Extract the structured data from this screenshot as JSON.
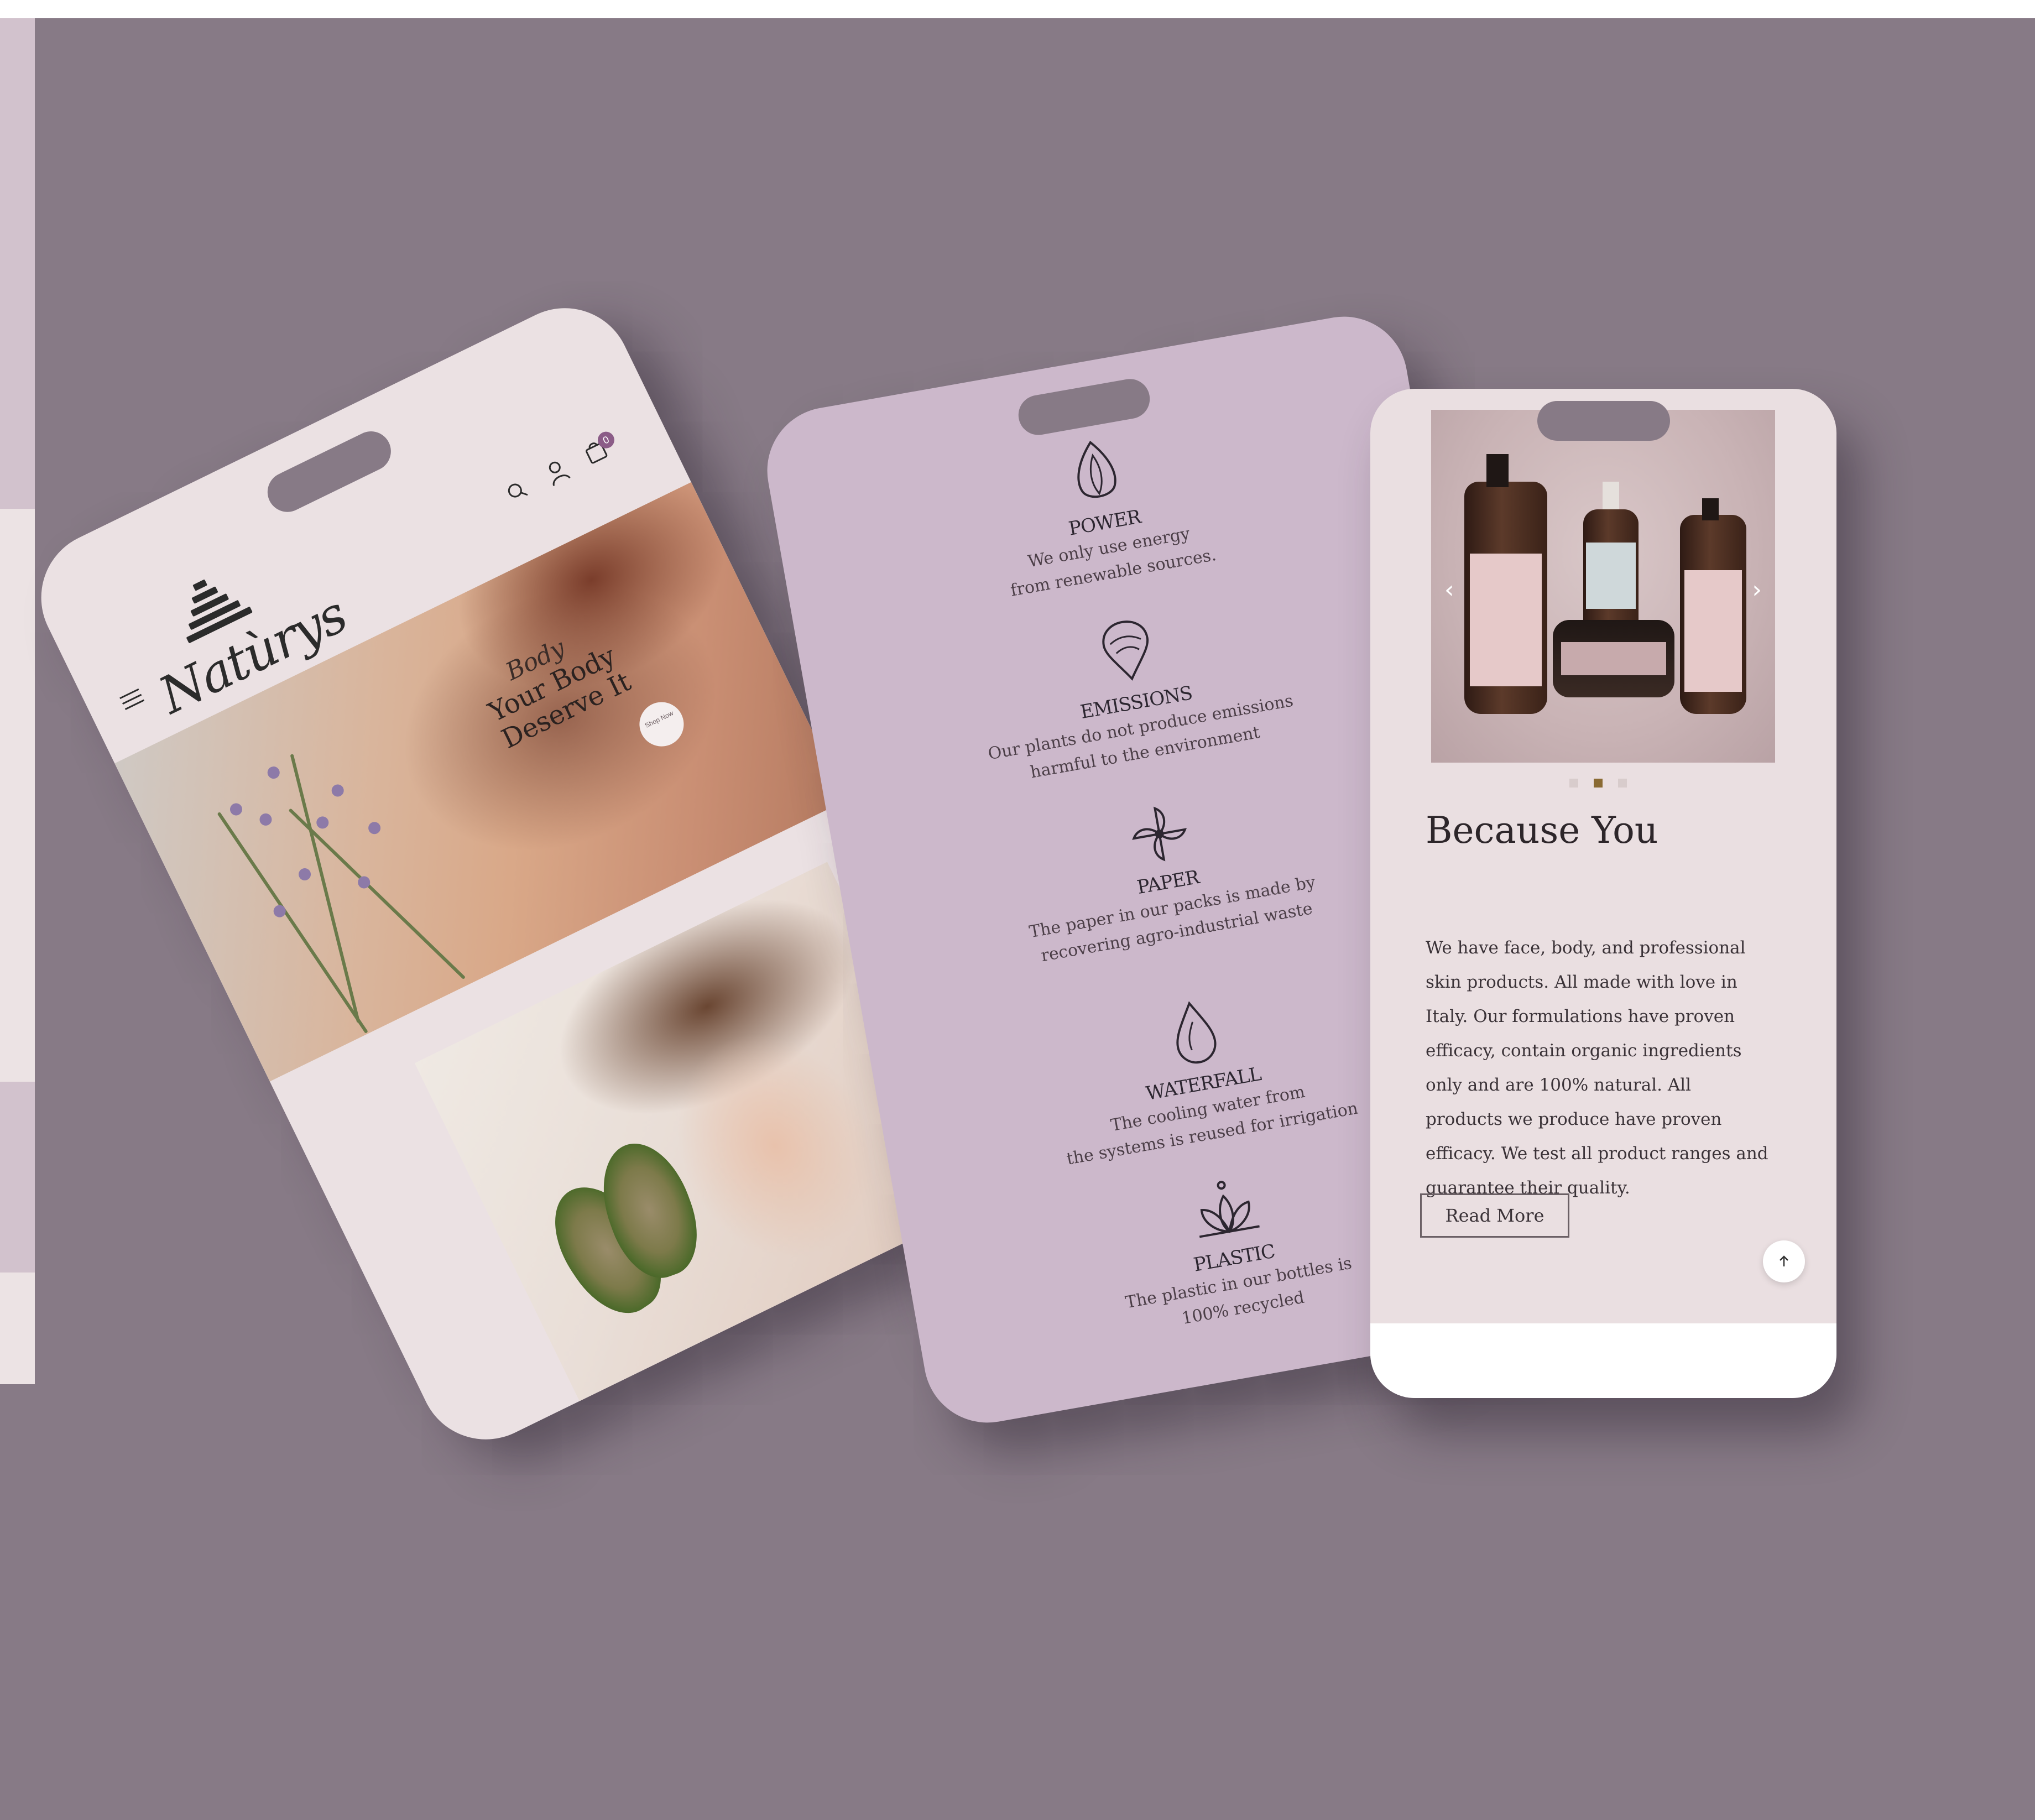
{
  "brand": {
    "name": "Natùrys"
  },
  "phone1": {
    "hero": {
      "script": "Body",
      "title": "Your Body Deserve It",
      "button": "Shop Now"
    },
    "cart_count": "0"
  },
  "phone2": {
    "features": [
      {
        "icon": "leaf-icon",
        "title": "POWER",
        "desc1": "We only use energy",
        "desc2": "from renewable sources."
      },
      {
        "icon": "location-leaf-icon",
        "title": "EMISSIONS",
        "desc1": "Our plants do not produce emissions",
        "desc2": "harmful to the environment"
      },
      {
        "icon": "pinwheel-icon",
        "title": "PAPER",
        "desc1": "The paper in our packs is made by",
        "desc2": "recovering agro-industrial waste"
      },
      {
        "icon": "water-drop-icon",
        "title": "WATERFALL",
        "desc1": "The cooling water from",
        "desc2": "the systems is reused for irrigation"
      },
      {
        "icon": "lotus-icon",
        "title": "PLASTIC",
        "desc1": "The plastic in our bottles is",
        "desc2": "100% recycled"
      }
    ]
  },
  "phone3": {
    "title": "Because You",
    "body": "We have face, body, and professional skin products. All made with love in Italy. Our formulations have proven efficacy, contain organic ingredients only and are 100% natural. All products we produce have proven efficacy. We test all product ranges and guarantee their quality.",
    "read_more": "Read More",
    "carousel": {
      "slides": 3,
      "active": 2
    }
  },
  "colors": {
    "background": "#877A86",
    "phone1": "#EBE1E3",
    "phone2": "#CCB8CB",
    "phone3": "#EADFE1",
    "accent": "#8a6a33"
  }
}
